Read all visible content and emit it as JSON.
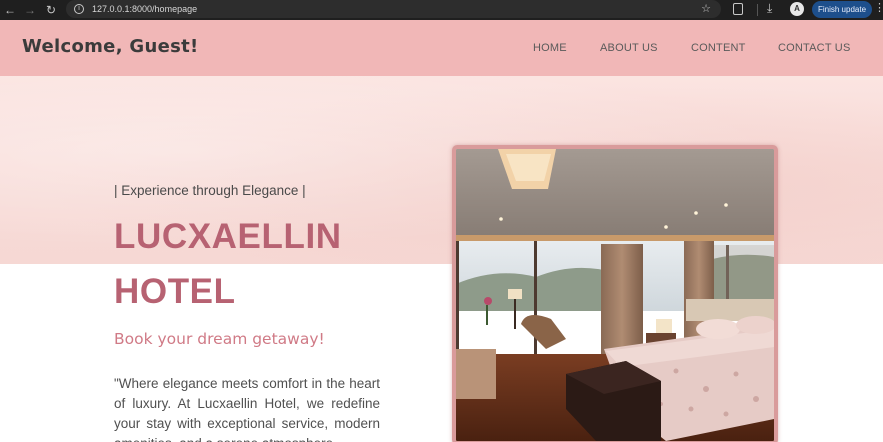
{
  "browser": {
    "url": "127.0.0.1:8000/homepage",
    "update_label": "Finish update",
    "icons": [
      "back-icon",
      "forward-icon",
      "reload-icon",
      "site-info-icon",
      "bookmark-star-icon",
      "extensions-icon",
      "download-icon",
      "profile-avatar",
      "menu-icon"
    ]
  },
  "header": {
    "brand": "Welcome, Guest!",
    "nav": [
      "HOME",
      "ABOUT US",
      "CONTENT",
      "CONTACT US"
    ]
  },
  "hero": {
    "tagline": "| Experience through Elegance |",
    "title_line1": "LUCXAELLIN",
    "title_line2": "HOTEL",
    "subtitle": "Book your dream getaway!",
    "quote": "\"Where elegance meets comfort in the heart of luxury. At Lucxaellin Hotel, we redefine your stay with exceptional service, modern amenities, and a serene atmosphere"
  },
  "colors": {
    "header_bg": "#f1b7b7",
    "title": "#b76272",
    "subtitle": "#d07a86",
    "frame": "#d99b9b"
  }
}
